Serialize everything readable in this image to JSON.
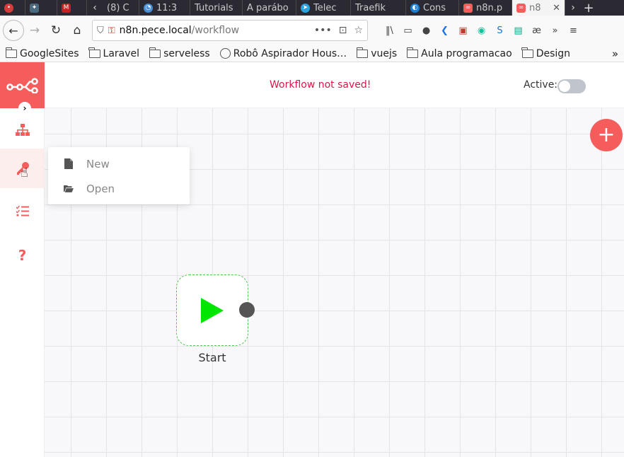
{
  "browser": {
    "tabs": [
      {
        "label": "",
        "icon": "chat-icon",
        "color": "#d93a3a"
      },
      {
        "label": "",
        "icon": "bird-icon",
        "color": "#4b6a7f"
      },
      {
        "label": "",
        "icon": "gmail-icon",
        "color": "#c5221f"
      },
      {
        "label": "(8) C",
        "icon": "",
        "color": "#888"
      },
      {
        "label": "11:3",
        "icon": "clock-icon",
        "color": "#4a90d9"
      },
      {
        "label": "Tutorials",
        "icon": "",
        "color": "#888"
      },
      {
        "label": "A parábo",
        "icon": "",
        "color": "#888"
      },
      {
        "label": "Telec",
        "icon": "telegram-icon",
        "color": "#2aa3df"
      },
      {
        "label": "Traefik",
        "icon": "",
        "color": "#888"
      },
      {
        "label": "Cons",
        "icon": "portainer-icon",
        "color": "#1a7fd4"
      },
      {
        "label": "n8n.p",
        "icon": "n8n-icon",
        "color": "#f55d5d"
      },
      {
        "label": "n8",
        "icon": "n8n-icon",
        "color": "#f55d5d",
        "active": true
      }
    ],
    "url": {
      "host": "n8n.pece.local",
      "path": "/workflow"
    },
    "bookmarks": [
      "GoogleSites",
      "Laravel",
      "serveless",
      "Robô Aspirador Hous…",
      "vuejs",
      "Aula programacao",
      "Design"
    ]
  },
  "app": {
    "status_text": "Workflow not saved!",
    "active_label": "Active:",
    "active": false,
    "menu": {
      "items": [
        {
          "label": "New",
          "icon": "file-icon"
        },
        {
          "label": "Open",
          "icon": "folder-open-icon"
        }
      ]
    },
    "node": {
      "label": "Start",
      "icon": "play-icon"
    },
    "colors": {
      "brand": "#f55d5d",
      "status": "#d6184a",
      "node_border": "#54c454",
      "play": "#00e600"
    }
  }
}
